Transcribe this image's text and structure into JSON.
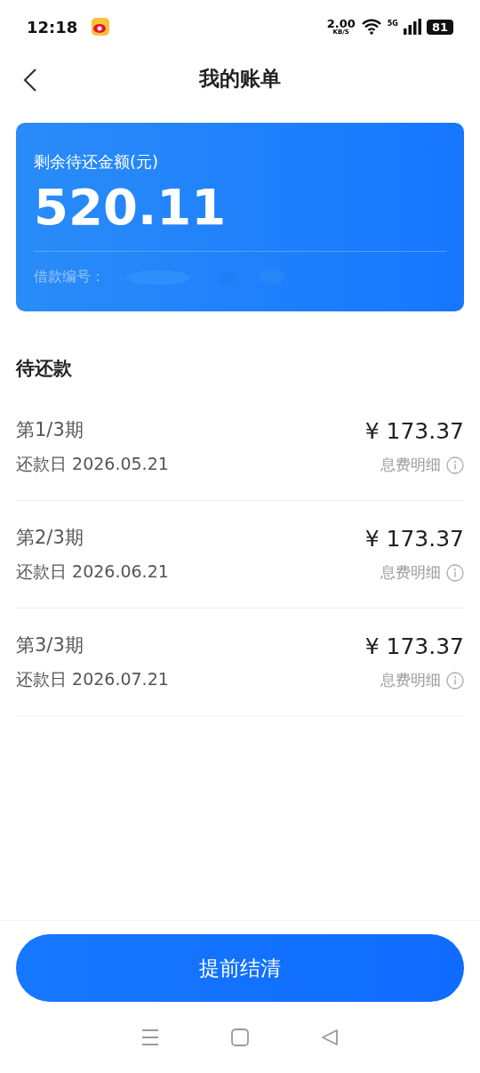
{
  "status_bar": {
    "time": "12:18",
    "speed_value": "2.00",
    "speed_unit": "KB/S",
    "network": "5G",
    "battery": "81"
  },
  "header": {
    "title": "我的账单"
  },
  "summary": {
    "label": "剩余待还金额(元)",
    "amount": "520.11",
    "loan_label": "借款编号："
  },
  "section": {
    "title": "待还款"
  },
  "installments": [
    {
      "period": "第1/3期",
      "due": "还款日 2026.05.21",
      "amount": "¥ 173.37",
      "detail": "息费明细"
    },
    {
      "period": "第2/3期",
      "due": "还款日 2026.06.21",
      "amount": "¥ 173.37",
      "detail": "息费明细"
    },
    {
      "period": "第3/3期",
      "due": "还款日 2026.07.21",
      "amount": "¥ 173.37",
      "detail": "息费明细"
    }
  ],
  "action": {
    "label": "提前结清"
  }
}
